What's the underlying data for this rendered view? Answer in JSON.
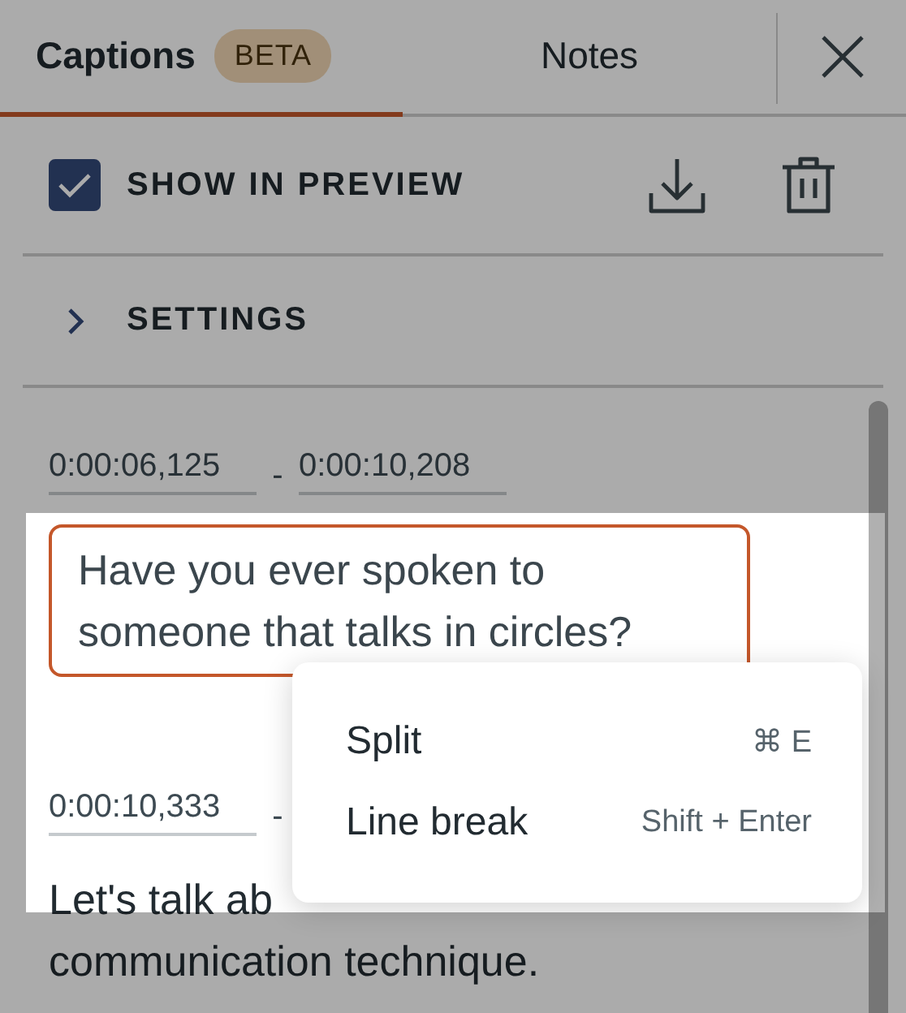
{
  "tabs": [
    {
      "label": "Captions",
      "badge": "BETA",
      "selected": true
    },
    {
      "label": "Notes",
      "selected": false
    }
  ],
  "show_in_preview": {
    "label": "SHOW IN PREVIEW",
    "checked": true
  },
  "settings": {
    "label": "SETTINGS",
    "expanded": false
  },
  "captions": [
    {
      "start": "0:00:06,125",
      "separator": "-",
      "end": "0:00:10,208",
      "lines": [
        "Have you ever spoken to",
        "someone that talks in circles?"
      ],
      "selected": true
    },
    {
      "start": "0:00:10,333",
      "separator": "-",
      "lines": [
        "Let's talk ab",
        "communication technique."
      ],
      "selected": false
    }
  ],
  "context_menu": {
    "items": [
      {
        "label": "Split",
        "shortcut": "⌘ E"
      },
      {
        "label": "Line break",
        "shortcut": "Shift + Enter"
      }
    ]
  }
}
